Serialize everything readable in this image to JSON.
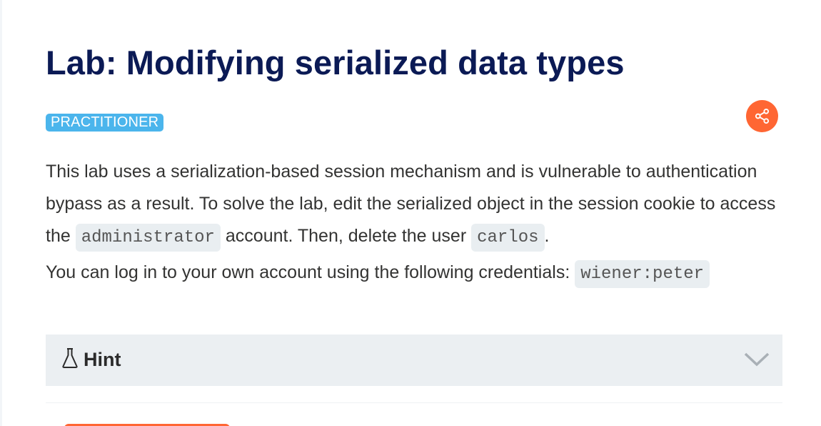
{
  "lab": {
    "title": "Lab: Modifying serialized data types",
    "level": "PRACTITIONER"
  },
  "description": {
    "part1": "This lab uses a serialization-based session mechanism and is vulnerable to authentication bypass as a result. To solve the lab, edit the serialized object in the session cookie to access the ",
    "code_admin": "administrator",
    "part2": " account. Then, delete the user ",
    "code_user": "carlos",
    "part3": ".",
    "creds_text": "You can log in to your own account using the following credentials: ",
    "code_creds": "wiener:peter"
  },
  "hint": {
    "label": "Hint",
    "icon": "flask-icon",
    "toggle_icon": "chevron-down-icon"
  },
  "colors": {
    "title": "#0b1a55",
    "badge": "#4bb5ec",
    "accent": "#ff6633",
    "code_bg": "#e9eef1",
    "hint_bg": "#ebeff2"
  }
}
